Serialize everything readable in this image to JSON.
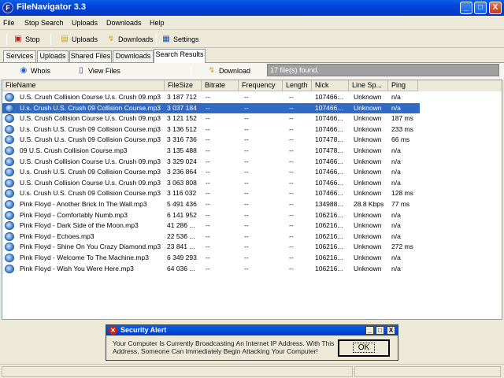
{
  "window": {
    "title": "FileNavigator 3.3",
    "icon_letter": "F"
  },
  "window_controls": {
    "minimize": "_",
    "maximize": "□",
    "close": "X"
  },
  "menu": [
    "File",
    "Stop Search",
    "Uploads",
    "Downloads",
    "Help"
  ],
  "toolbar": {
    "stop": "Stop",
    "uploads": "Uploads",
    "downloads": "Downloads",
    "settings": "Settings"
  },
  "tabs": [
    "Services",
    "Uploads",
    "Shared Files",
    "Downloads",
    "Search Results"
  ],
  "active_tab": "Search Results",
  "search_bar": {
    "whois": "Whois",
    "view_files": "View Files",
    "download": "Download",
    "status": "17 file(s) found."
  },
  "columns": [
    "FileName",
    "FileSize",
    "Bitrate",
    "Frequency",
    "Length",
    "Nick",
    "Line Sp...",
    "Ping"
  ],
  "rows": [
    {
      "file": "U.S. Crush Collision Course U.s. Crush 09.mp3",
      "size": "3 187 712",
      "bitrate": "--",
      "freq": "--",
      "length": "--",
      "nick": "107466...",
      "line": "Unknown",
      "ping": "n/a"
    },
    {
      "file": "U.s. Crush U.S. Crush 09 Collision Course.mp3",
      "size": "3 037 184",
      "bitrate": "--",
      "freq": "--",
      "length": "--",
      "nick": "107466...",
      "line": "Unknown",
      "ping": "n/a"
    },
    {
      "file": "U.S. Crush Collision Course U.s. Crush 09.mp3",
      "size": "3 121 152",
      "bitrate": "--",
      "freq": "--",
      "length": "--",
      "nick": "107466...",
      "line": "Unknown",
      "ping": "187 ms"
    },
    {
      "file": "U.s. Crush U.S. Crush 09 Collision Course.mp3",
      "size": "3 136 512",
      "bitrate": "--",
      "freq": "--",
      "length": "--",
      "nick": "107466...",
      "line": "Unknown",
      "ping": "233 ms"
    },
    {
      "file": "U.S. Crush U.s. Crush 09 Collision Course.mp3",
      "size": "3 316 736",
      "bitrate": "--",
      "freq": "--",
      "length": "--",
      "nick": "107478...",
      "line": "Unknown",
      "ping": "66 ms"
    },
    {
      "file": "09 U.S. Crush Collision Course.mp3",
      "size": "3 135 488",
      "bitrate": "--",
      "freq": "--",
      "length": "--",
      "nick": "107478...",
      "line": "Unknown",
      "ping": "n/a"
    },
    {
      "file": "U.S. Crush Collision Course U.s. Crush 09.mp3",
      "size": "3 329 024",
      "bitrate": "--",
      "freq": "--",
      "length": "--",
      "nick": "107466...",
      "line": "Unknown",
      "ping": "n/a"
    },
    {
      "file": "U.s. Crush U.S. Crush 09 Collision Course.mp3",
      "size": "3 236 864",
      "bitrate": "--",
      "freq": "--",
      "length": "--",
      "nick": "107466...",
      "line": "Unknown",
      "ping": "n/a"
    },
    {
      "file": "U.S. Crush Collision Course U.s. Crush 09.mp3",
      "size": "3 063 808",
      "bitrate": "--",
      "freq": "--",
      "length": "--",
      "nick": "107466...",
      "line": "Unknown",
      "ping": "n/a"
    },
    {
      "file": "U.s. Crush U.S. Crush 09 Collision Course.mp3",
      "size": "3 116 032",
      "bitrate": "--",
      "freq": "--",
      "length": "--",
      "nick": "107466...",
      "line": "Unknown",
      "ping": "128 ms"
    },
    {
      "file": "Pink Floyd - Another Brick In The Wall.mp3",
      "size": "5 491 436",
      "bitrate": "--",
      "freq": "--",
      "length": "--",
      "nick": "134988...",
      "line": "28.8 Kbps",
      "ping": "77 ms"
    },
    {
      "file": "Pink Floyd - Comfortably Numb.mp3",
      "size": "6 141 952",
      "bitrate": "--",
      "freq": "--",
      "length": "--",
      "nick": "106216...",
      "line": "Unknown",
      "ping": "n/a"
    },
    {
      "file": "Pink Floyd - Dark Side of the Moon.mp3",
      "size": "41 286 ...",
      "bitrate": "--",
      "freq": "--",
      "length": "--",
      "nick": "106216...",
      "line": "Unknown",
      "ping": "n/a"
    },
    {
      "file": "Pink Floyd - Echoes.mp3",
      "size": "22 536 ...",
      "bitrate": "--",
      "freq": "--",
      "length": "--",
      "nick": "106216...",
      "line": "Unknown",
      "ping": "n/a"
    },
    {
      "file": "Pink Floyd - Shine On You Crazy Diamond.mp3",
      "size": "23 841 ...",
      "bitrate": "--",
      "freq": "--",
      "length": "--",
      "nick": "106216...",
      "line": "Unknown",
      "ping": "272 ms"
    },
    {
      "file": "Pink Floyd - Welcome To The Machine.mp3",
      "size": "6 349 293",
      "bitrate": "--",
      "freq": "--",
      "length": "--",
      "nick": "106216...",
      "line": "Unknown",
      "ping": "n/a"
    },
    {
      "file": "Pink Floyd - Wish You Were Here.mp3",
      "size": "64 036 ...",
      "bitrate": "--",
      "freq": "--",
      "length": "--",
      "nick": "106216...",
      "line": "Unknown",
      "ping": "n/a"
    }
  ],
  "selected_row": 1,
  "alert": {
    "title": "Security Alert",
    "icon": "x-icon",
    "message": "Your Computer Is Currently Broadcasting An Internet IP Address. With This Address, Someone Can Immediately Begin Attacking Your Computer!",
    "ok": "OK",
    "controls": {
      "minimize": "_",
      "maximize": "□",
      "close": "X"
    }
  },
  "colors": {
    "titlebar": "#0045d8",
    "selection": "#316ac5",
    "face": "#ece9d8"
  }
}
